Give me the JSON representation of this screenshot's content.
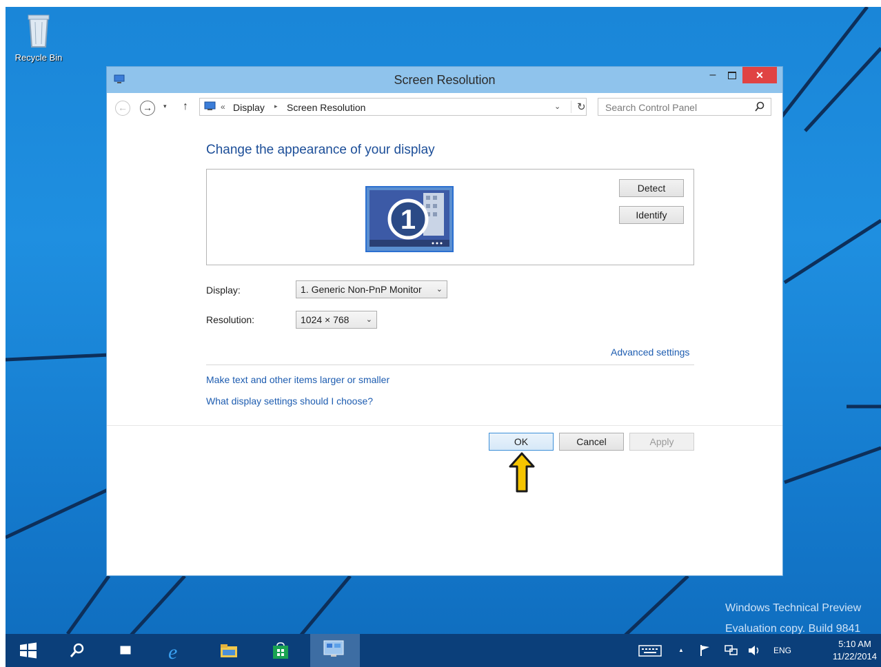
{
  "desktop": {
    "recycle_bin_label": "Recycle Bin",
    "watermark_line1": "Windows Technical Preview",
    "watermark_line2": "Evaluation copy. Build 9841",
    "accent": "#1a86d8"
  },
  "window": {
    "title": "Screen Resolution",
    "minimize_glyph": "–",
    "close_glyph": "✕",
    "titlebar_color": "#8fc3ec"
  },
  "navbar": {
    "back_glyph": "←",
    "forward_glyph": "→",
    "recent_glyph": "▾",
    "up_glyph": "↑",
    "address_sep": "«",
    "crumb_display": "Display",
    "crumb_arrow": "▸",
    "crumb_screen_resolution": "Screen Resolution",
    "dropdown_glyph": "⌄",
    "refresh_glyph": "↻",
    "search_placeholder": "Search Control Panel"
  },
  "content": {
    "heading": "Change the appearance of your display",
    "detect_label": "Detect",
    "identify_label": "Identify",
    "monitor_number": "1",
    "display_label": "Display:",
    "display_value": "1. Generic Non-PnP Monitor",
    "resolution_label": "Resolution:",
    "resolution_value": "1024 × 768",
    "select_chevron": "⌄",
    "advanced_settings": "Advanced settings",
    "link_larger": "Make text and other items larger or smaller",
    "link_choose": "What display settings should I choose?",
    "link_color": "#1d5cb0"
  },
  "footer": {
    "ok_label": "OK",
    "cancel_label": "Cancel",
    "apply_label": "Apply"
  },
  "taskbar": {
    "items": [
      "start-icon",
      "search-icon",
      "task-view-icon",
      "internet-explorer-icon",
      "file-explorer-icon",
      "store-icon",
      "control-panel-icon"
    ],
    "tray_lang": "ENG",
    "tray_up": "▲",
    "clock_time": "5:10 AM",
    "clock_date": "11/22/2014"
  }
}
